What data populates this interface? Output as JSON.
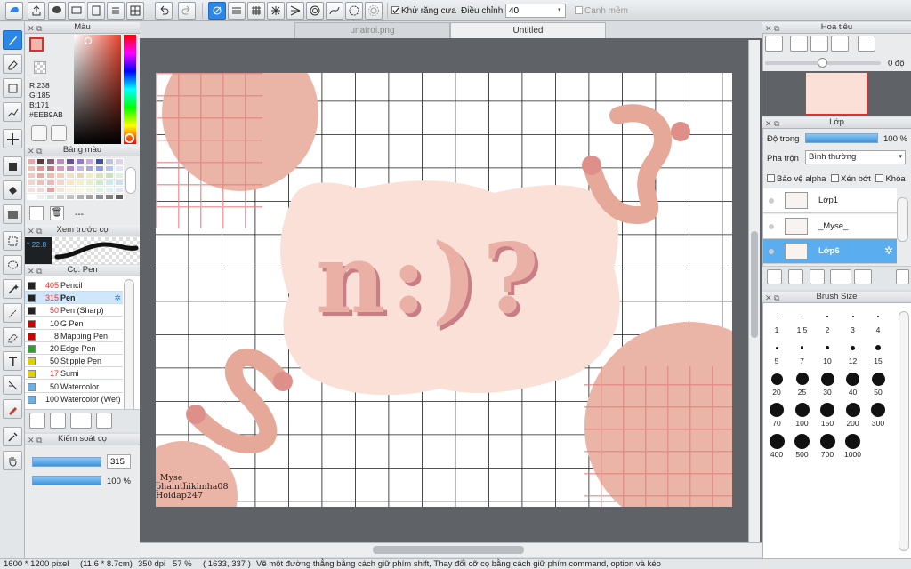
{
  "toolbar": {
    "antialias_label": "Khử răng cưa",
    "adjust_label": "Điều chỉnh",
    "adjust_value": "40",
    "smooth_label": "Cạnh mềm"
  },
  "tabs": [
    {
      "label": "unatroi.png"
    },
    {
      "label": "Untitled"
    }
  ],
  "color_panel": {
    "title": "Màu",
    "r": "R:238",
    "g": "G:185",
    "b": "B:171",
    "hex": "#EEB9AB",
    "current_color": "#EEB9AB"
  },
  "swatch_panel": {
    "title": "Bảng màu",
    "dashes": "---",
    "colors": [
      "#f5a0a0",
      "#5e3b3b",
      "#8a5a7a",
      "#c08ac0",
      "#6a4fa0",
      "#9a78d0",
      "#d0a0e0",
      "#3a4fb0",
      "#c0c0e0",
      "#e0d0f0",
      "#f4b8b8",
      "#e39494",
      "#c97a86",
      "#d99abf",
      "#b589d0",
      "#c7b3e8",
      "#a8a8dc",
      "#8fa0e8",
      "#b6c4f0",
      "#dfe6f7",
      "#f2c7c0",
      "#e9aaa0",
      "#f4b7a8",
      "#f3cdb8",
      "#f3dfc9",
      "#e8d7b8",
      "#f3ecc0",
      "#d8e8b0",
      "#c9e3c0",
      "#e0f0e0",
      "#f6d2c8",
      "#efc0b8",
      "#f2b5b5",
      "#f5d6c6",
      "#fbe6c0",
      "#f6f0c6",
      "#e4f2c4",
      "#c9eec8",
      "#c6ecec",
      "#cde0f4",
      "#f7e0dc",
      "#f3d8d8",
      "#ef9c9c",
      "#f7e4d4",
      "#fdf2dc",
      "#fff7d6",
      "#eef8d6",
      "#dcf6dc",
      "#d8f4f4",
      "#dce8f8",
      "#ffffff",
      "#f0f0f0",
      "#e0e0e0",
      "#d0d0d0",
      "#c0c0c0",
      "#b0b0b0",
      "#a0a0a0",
      "#909090",
      "#808080",
      "#606060"
    ]
  },
  "preview_panel": {
    "title": "Xem trước cọ",
    "size": "22.8"
  },
  "brush_panel": {
    "title": "Cọ: Pen",
    "items": [
      {
        "num": "405",
        "name": "Pencil",
        "color": "#222222",
        "num_color": "#d33"
      },
      {
        "num": "315",
        "name": "Pen",
        "color": "#222222",
        "num_color": "#d33"
      },
      {
        "num": "50",
        "name": "Pen (Sharp)",
        "color": "#222222",
        "num_color": "#d33"
      },
      {
        "num": "10",
        "name": "G Pen",
        "color": "#d00000",
        "num_color": "#222"
      },
      {
        "num": "8",
        "name": "Mapping Pen",
        "color": "#d00000",
        "num_color": "#222"
      },
      {
        "num": "20",
        "name": "Edge Pen",
        "color": "#2ca02c",
        "num_color": "#222"
      },
      {
        "num": "50",
        "name": "Stipple Pen",
        "color": "#e0d000",
        "num_color": "#222"
      },
      {
        "num": "17",
        "name": "Sumi",
        "color": "#e0d000",
        "num_color": "#d33"
      },
      {
        "num": "50",
        "name": "Watercolor",
        "color": "#6fb0e0",
        "num_color": "#222"
      },
      {
        "num": "100",
        "name": "Watercolor (Wet)",
        "color": "#6fb0e0",
        "num_color": "#222"
      }
    ]
  },
  "control_panel": {
    "title": "Kiểm soát cọ",
    "size_value": "315",
    "opacity_value": "100 %"
  },
  "navigator": {
    "title": "Hoa tiêu",
    "angle": "0 độ"
  },
  "layer_panel": {
    "title": "Lớp",
    "opacity_label": "Độ trong",
    "opacity_value": "100 %",
    "opacity_fraction": 1.0,
    "blend_label": "Pha trộn",
    "blend_value": "Bình thường",
    "protect_alpha": "Bảo vệ alpha",
    "clipping": "Xén bớt",
    "lock": "Khóa",
    "layers": [
      {
        "name": "Lớp1",
        "selected": false
      },
      {
        "name": "_Myse_",
        "selected": false
      },
      {
        "name": "Lớp6",
        "selected": true
      }
    ]
  },
  "brush_size": {
    "title": "Brush Size",
    "sizes": [
      "1",
      "1.5",
      "2",
      "3",
      "4",
      "5",
      "7",
      "10",
      "12",
      "15",
      "20",
      "25",
      "30",
      "40",
      "50",
      "70",
      "100",
      "150",
      "200",
      "300",
      "400",
      "500",
      "700",
      "1000"
    ]
  },
  "canvas": {
    "art_text": "n:)?",
    "signature_lines": [
      "_Myse_",
      "phamthikimha08",
      "Hoidap247"
    ]
  },
  "status": {
    "dimensions": "1600 * 1200 pixel",
    "physical": "(11.6 * 8.7cm)",
    "dpi": "350 dpi",
    "zoom": "57 %",
    "coords": "( 1633, 337 )",
    "hint": "Vẽ một đường thẳng bằng cách giữ phím shift, Thay đổi cỡ cọ bằng cách giữ phím command, option và kéo"
  }
}
